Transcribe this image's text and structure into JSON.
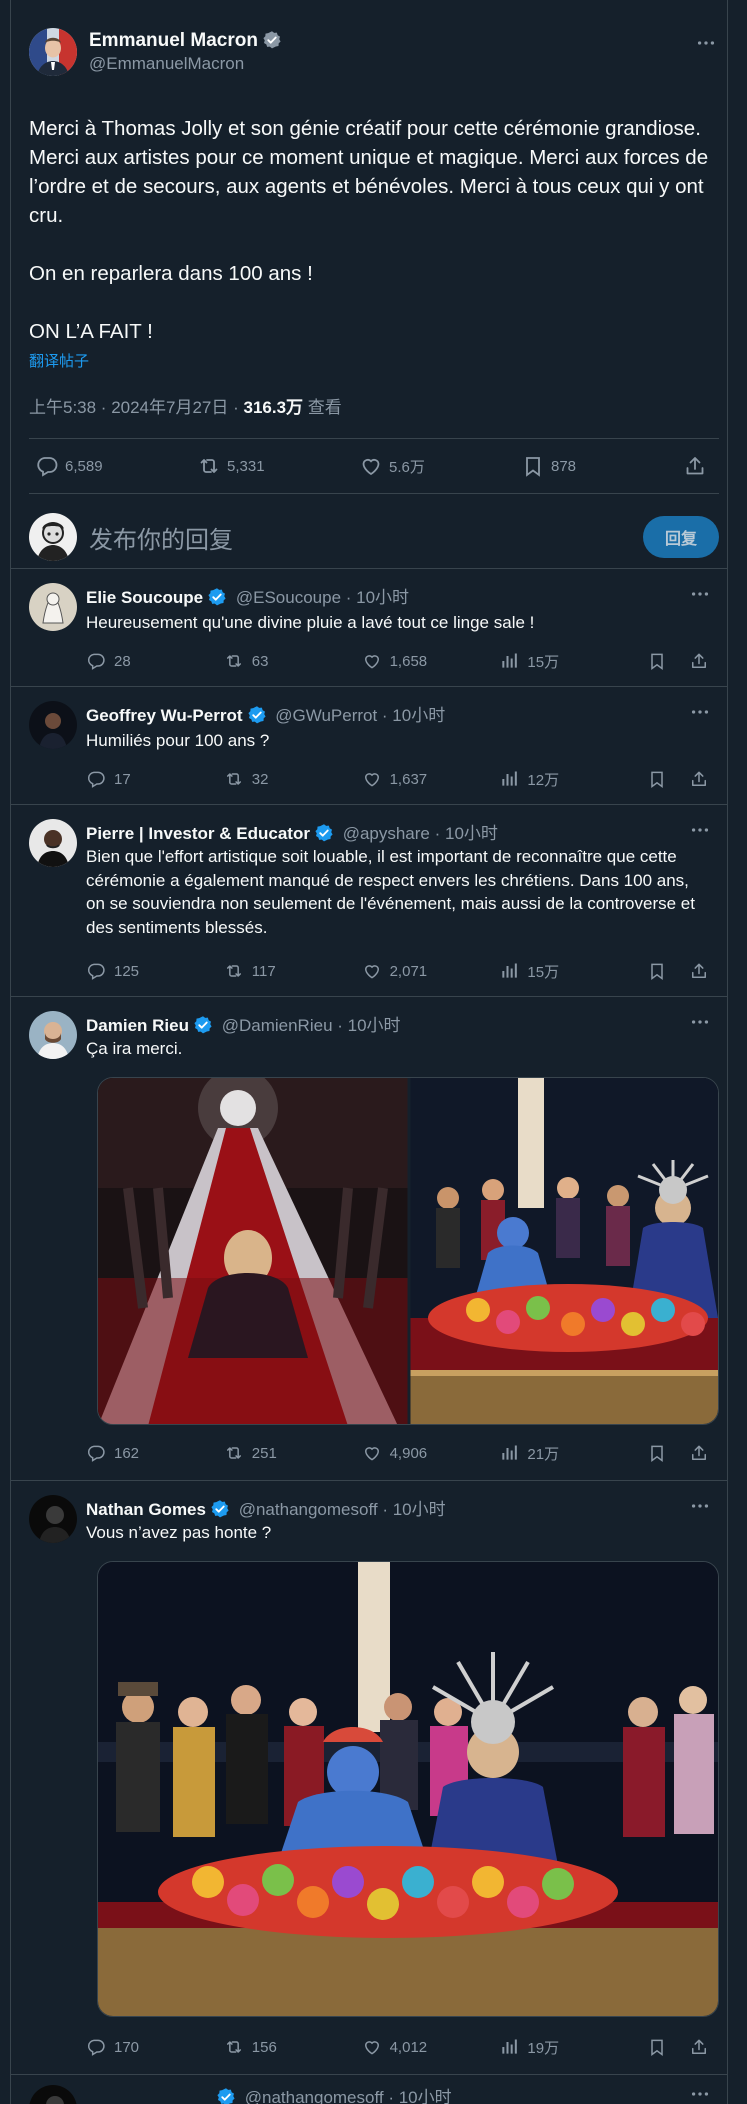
{
  "main_tweet": {
    "author_name": "Emmanuel Macron",
    "author_handle": "@EmmanuelMacron",
    "text": "Merci à Thomas Jolly et son génie créatif pour cette cérémonie grandiose. Merci aux artistes pour ce moment unique et magique. Merci aux forces de l’ordre et de secours, aux agents et bénévoles. Merci à tous ceux qui y ont cru.\n\nOn en reparlera dans 100 ans !\n\nON L’A FAIT !",
    "translate_label": "翻译帖子",
    "time": "上午5:38 · 2024年7月27日 · ",
    "views": "316.3万",
    "views_label": " 查看",
    "replies": "6,589",
    "retweets": "5,331",
    "likes": "5.6万",
    "bookmarks": "878"
  },
  "composer": {
    "placeholder": "发布你的回复",
    "button": "回复"
  },
  "replies": [
    {
      "name": "Elie Soucoupe",
      "handle": "@ESoucoupe · 10小时",
      "text": "Heureusement qu'une divine pluie a lavé tout ce linge sale !",
      "replies": "28",
      "retweets": "63",
      "likes": "1,658",
      "views": "15万"
    },
    {
      "name": "Geoffrey Wu-Perrot",
      "handle": "@GWuPerrot · 10小时",
      "text": "Humiliés pour 100 ans ?",
      "replies": "17",
      "retweets": "32",
      "likes": "1,637",
      "views": "12万"
    },
    {
      "name": "Pierre | Investor & Educator",
      "handle": "@apyshare · 10小时",
      "text": "Bien que l'effort artistique soit louable, il est important de reconnaître que cette cérémonie a également manqué de respect envers les chrétiens. Dans 100 ans, on se souviendra non seulement de l'événement, mais aussi de la controverse et des sentiments blessés.",
      "replies": "125",
      "retweets": "117",
      "likes": "2,071",
      "views": "15万"
    },
    {
      "name": "Damien Rieu",
      "handle": "@DamienRieu · 10小时",
      "text": "Ça ira merci.",
      "replies": "162",
      "retweets": "251",
      "likes": "4,906",
      "views": "21万"
    },
    {
      "name": "Nathan Gomes",
      "handle": "@nathangomesoff · 10小时",
      "text": "Vous n’avez pas honte ?",
      "replies": "170",
      "retweets": "156",
      "likes": "4,012",
      "views": "19万"
    },
    {
      "handle": "@nathangomesoff · 10小时"
    }
  ],
  "colors": {
    "background": "#15202b",
    "text": "#f7f9f9",
    "muted": "#8b98a5",
    "accent": "#1d9bf0",
    "border": "#38444d"
  }
}
